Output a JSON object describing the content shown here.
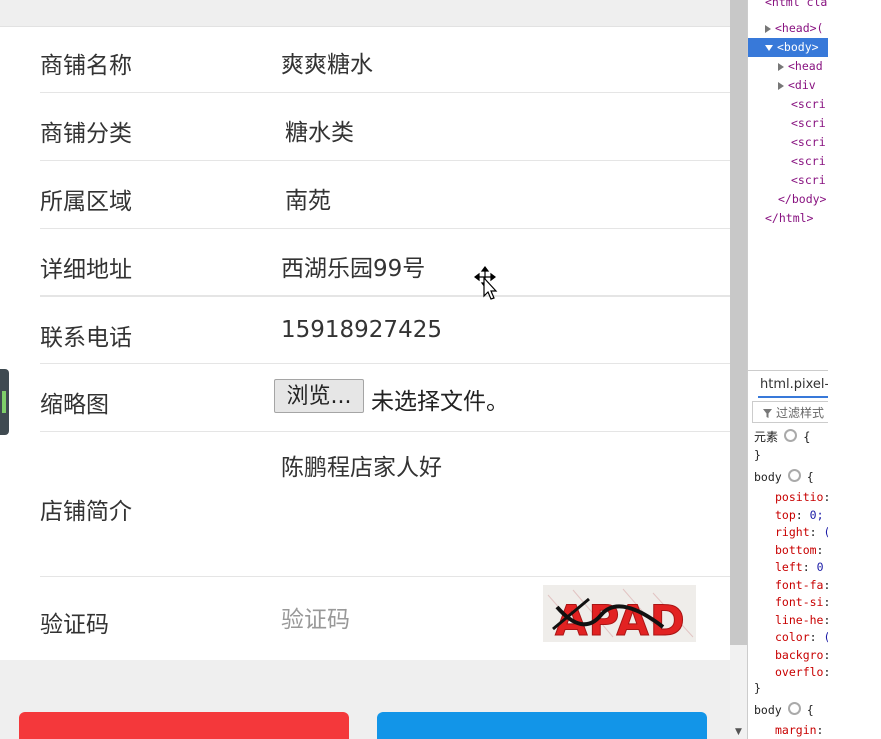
{
  "form": {
    "shop_name": {
      "label": "商铺名称",
      "value": "爽爽糖水"
    },
    "category": {
      "label": "商铺分类",
      "value": "糖水类"
    },
    "region": {
      "label": "所属区域",
      "value": "南苑"
    },
    "address": {
      "label": "详细地址",
      "value": "西湖乐园99号"
    },
    "phone": {
      "label": "联系电话",
      "value": "15918927425"
    },
    "thumbnail": {
      "label": "缩略图",
      "browse_label": "浏览...",
      "file_status": "未选择文件。"
    },
    "intro": {
      "label": "店铺简介",
      "value": "陈鹏程店家人好"
    },
    "captcha": {
      "label": "验证码",
      "placeholder": "验证码",
      "image_text": "APAD"
    }
  },
  "colors": {
    "cancel_button": "#f4383b",
    "submit_button": "#1295e8",
    "selection": "#3879d9"
  },
  "devtools": {
    "tree": [
      {
        "text": "<html cla",
        "indent": 0,
        "arrow": "none"
      },
      {
        "text": "<head>(",
        "indent": 1,
        "arrow": "right"
      },
      {
        "text": "<body>",
        "indent": 1,
        "arrow": "down",
        "selected": true
      },
      {
        "text": "<head",
        "indent": 2,
        "arrow": "right"
      },
      {
        "text": "<div",
        "indent": 2,
        "arrow": "right"
      },
      {
        "text": "<scri",
        "indent": 2,
        "arrow": "none"
      },
      {
        "text": "<scri",
        "indent": 2,
        "arrow": "none"
      },
      {
        "text": "<scri",
        "indent": 2,
        "arrow": "none"
      },
      {
        "text": "<scri",
        "indent": 2,
        "arrow": "none"
      },
      {
        "text": "<scri",
        "indent": 2,
        "arrow": "none"
      },
      {
        "text": "</body>",
        "indent": 1,
        "arrow": "none"
      },
      {
        "text": "</html>",
        "indent": 0,
        "arrow": "none"
      }
    ],
    "styles_tab": "html.pixel-",
    "filter_placeholder": "过滤样式",
    "element_rule": "元素",
    "body_rule": "body",
    "body_props": [
      {
        "name": "positio",
        "value": ""
      },
      {
        "name": "top",
        "value": "0;"
      },
      {
        "name": "right",
        "value": "("
      },
      {
        "name": "bottom",
        "value": ""
      },
      {
        "name": "left",
        "value": "0"
      },
      {
        "name": "font-fa",
        "value": ""
      },
      {
        "name": "font-si",
        "value": ""
      },
      {
        "name": "line-he",
        "value": ""
      },
      {
        "name": "color",
        "value": "("
      },
      {
        "name": "backgro",
        "value": ""
      },
      {
        "name": "overflo",
        "value": ""
      }
    ],
    "body_rule2": "body",
    "body2_props": [
      {
        "name": "margin",
        "value": "↵"
      }
    ]
  }
}
